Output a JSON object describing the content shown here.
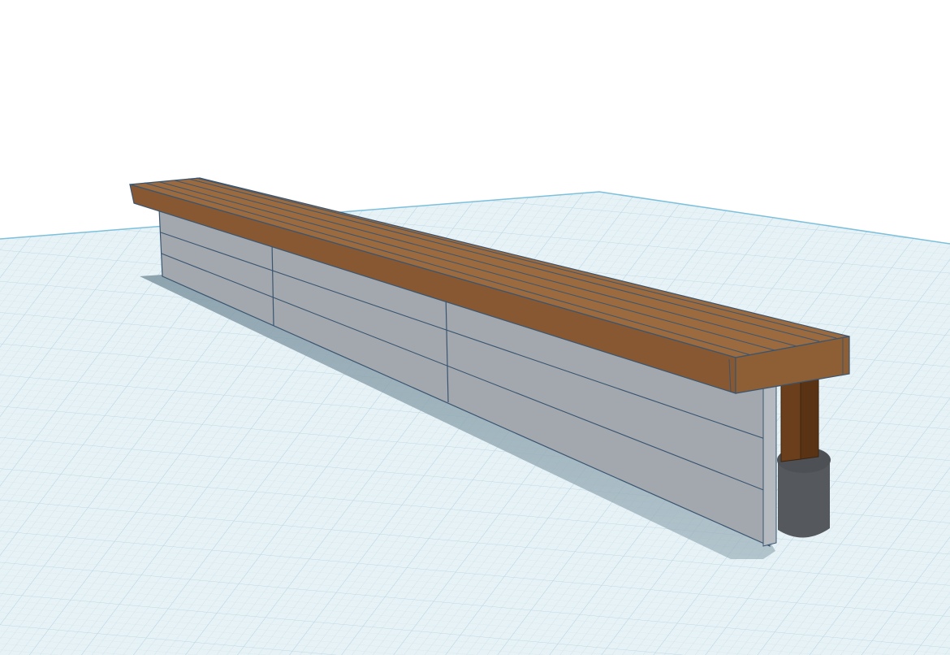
{
  "viewport": {
    "background_color": "#ffffff",
    "workplane_color": "#e6f1f5",
    "grid_minor_color": "#c9dde6",
    "grid_major_color": "#a9cfe0",
    "workplane_edge_color": "#7cc0db",
    "shadow_color": "#8aa0ab"
  },
  "model": {
    "name": "bench",
    "parts": [
      {
        "part": "seat-top",
        "color": "#9a6a3f"
      },
      {
        "part": "seat-front",
        "color": "#8a5a33"
      },
      {
        "part": "seat-end",
        "color": "#8f6036"
      },
      {
        "part": "wall-panel",
        "color": "#a4aab0"
      },
      {
        "part": "post",
        "color": "#6b3f1c"
      },
      {
        "part": "post-base",
        "color": "#55595d"
      }
    ],
    "edge_color": "#3a5570"
  }
}
